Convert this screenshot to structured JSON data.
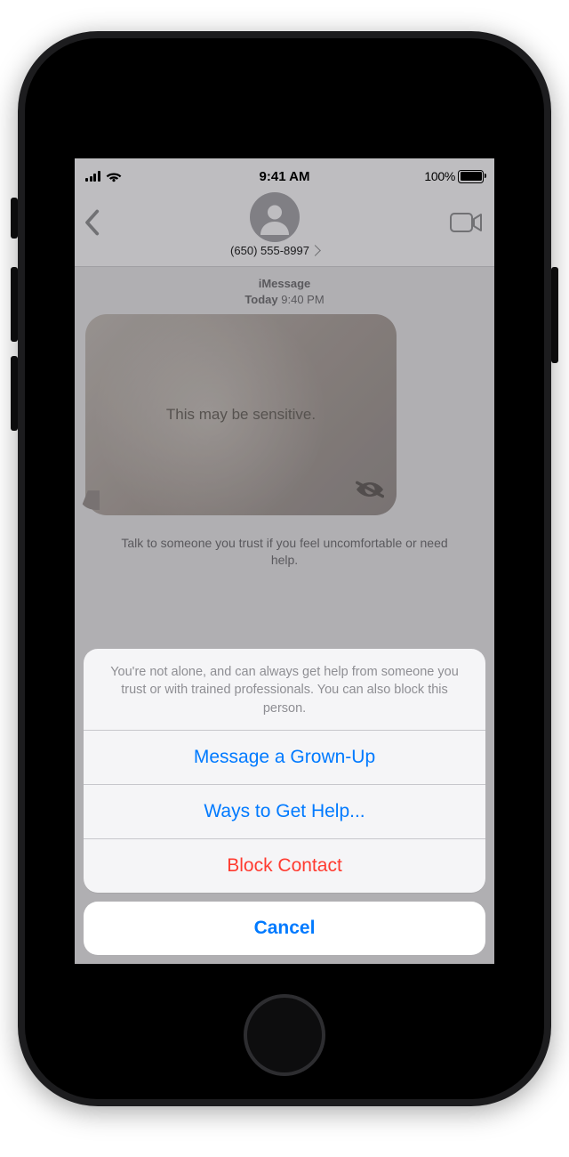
{
  "status": {
    "time": "9:41 AM",
    "battery_pct": "100%"
  },
  "chat": {
    "contact_number": "(650) 555-8997",
    "service": "iMessage",
    "day_label": "Today",
    "time_label": "9:40 PM",
    "sensitive_label": "This may be sensitive.",
    "safety_inline": "Talk to someone you trust if you feel uncomfortable or need help."
  },
  "sheet": {
    "message": "You're not alone, and can always get help from someone you trust or with trained professionals. You can also block this person.",
    "opt_message_grownup": "Message a Grown-Up",
    "opt_ways_help": "Ways to Get Help...",
    "opt_block": "Block Contact",
    "cancel": "Cancel"
  }
}
